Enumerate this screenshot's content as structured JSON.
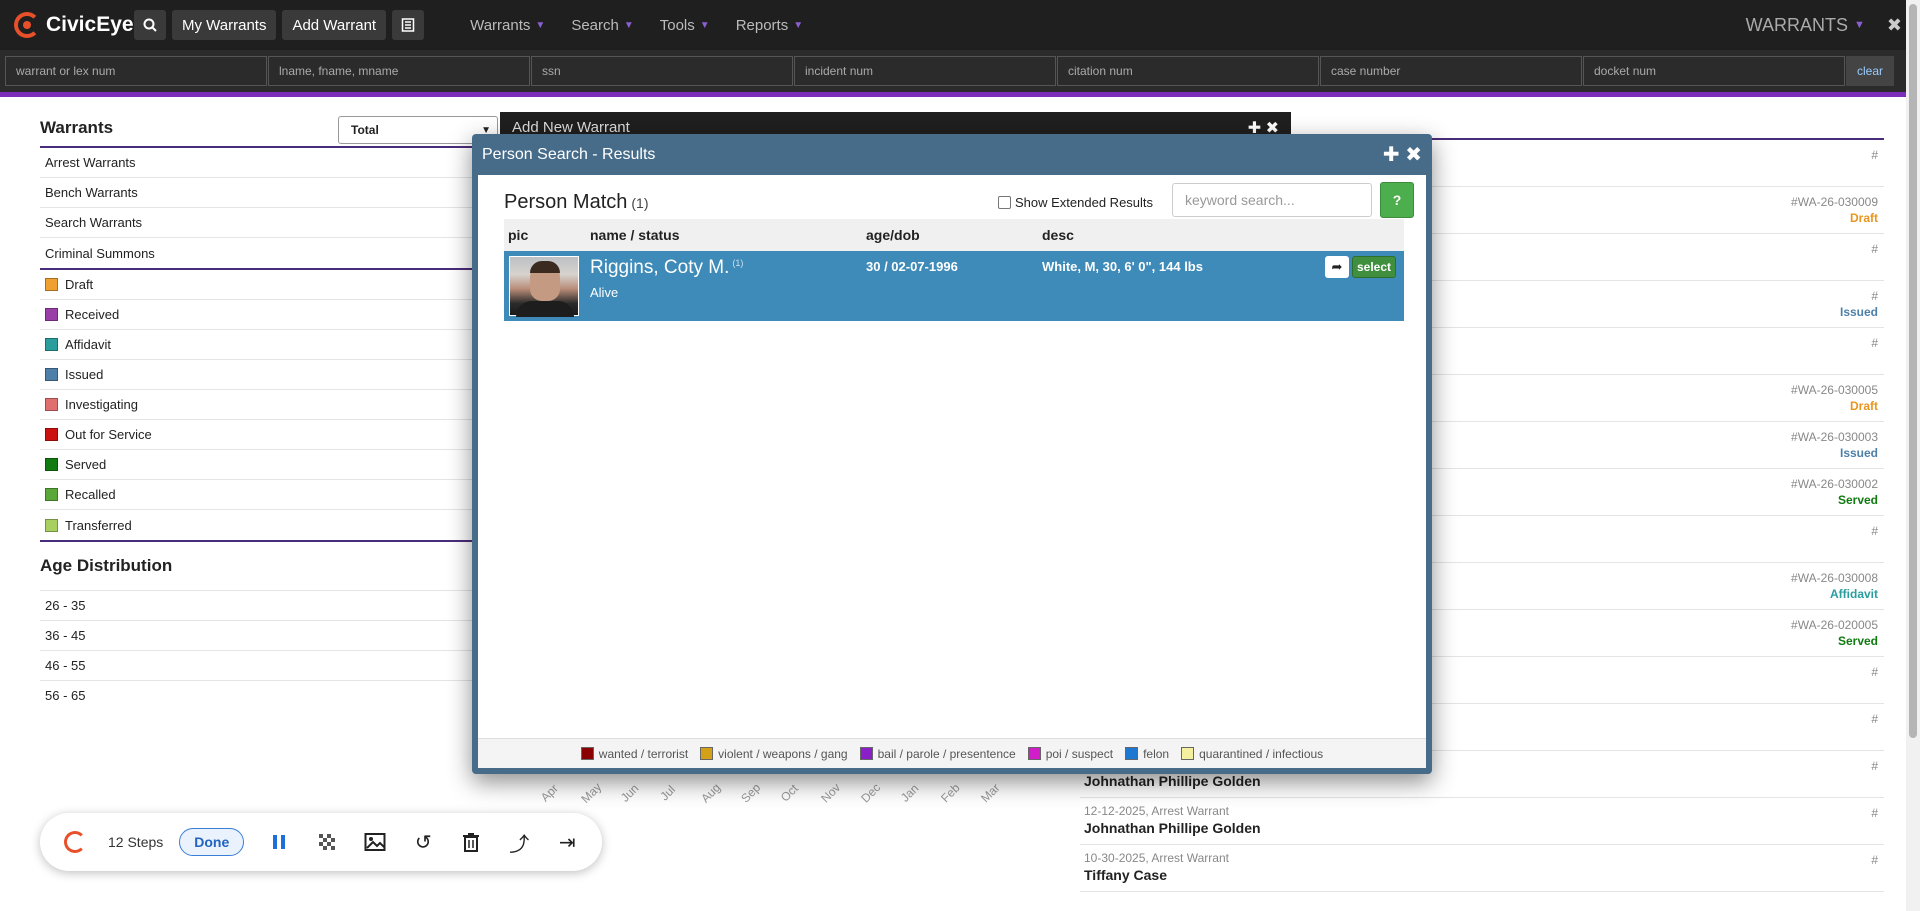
{
  "app": {
    "name": "CivicEye"
  },
  "topnav": {
    "my_warrants": "My Warrants",
    "add_warrant": "Add Warrant",
    "menus": [
      "Warrants",
      "Search",
      "Tools",
      "Reports"
    ],
    "module": "WARRANTS"
  },
  "search": {
    "placeholders": [
      "warrant or lex num",
      "lname, fname, mname",
      "ssn",
      "incident num",
      "citation num",
      "case number",
      "docket num"
    ],
    "clear": "clear"
  },
  "left": {
    "title": "Warrants",
    "select_value": "Total",
    "types": [
      "Arrest Warrants",
      "Bench Warrants",
      "Search Warrants",
      "Criminal Summons"
    ],
    "statuses": [
      {
        "label": "Draft",
        "color": "#f0a030"
      },
      {
        "label": "Received",
        "color": "#9b3fa8"
      },
      {
        "label": "Affidavit",
        "color": "#2a9d9d"
      },
      {
        "label": "Issued",
        "color": "#4e7fa8"
      },
      {
        "label": "Investigating",
        "color": "#e07070"
      },
      {
        "label": "Out for Service",
        "color": "#cc1111"
      },
      {
        "label": "Served",
        "color": "#117a11"
      },
      {
        "label": "Recalled",
        "color": "#5aa83a"
      },
      {
        "label": "Transferred",
        "color": "#a8d060"
      }
    ],
    "age_title": "Age Distribution",
    "ages": [
      "26 - 35",
      "36 - 45",
      "46 - 55",
      "56 - 65"
    ]
  },
  "add_new_warrant": {
    "title": "Add New Warrant"
  },
  "months": [
    "Apr",
    "May",
    "Jun",
    "Jul",
    "Aug",
    "Sep",
    "Oct",
    "Nov",
    "Dec",
    "Jan",
    "Feb",
    "Mar"
  ],
  "right_list": [
    {
      "hash": "#",
      "status": "",
      "color": ""
    },
    {
      "hash": "#WA-26-030009",
      "status": "Draft",
      "color": "#e8961e"
    },
    {
      "hash": "#",
      "status": "",
      "color": ""
    },
    {
      "hash": "#",
      "status": "Issued",
      "color": "#4e7fa8"
    },
    {
      "hash": "#",
      "status": "",
      "color": ""
    },
    {
      "hash": "#WA-26-030005",
      "status": "Draft",
      "color": "#e8961e"
    },
    {
      "hash": "#WA-26-030003",
      "status": "Issued",
      "color": "#4e7fa8"
    },
    {
      "hash": "#WA-26-030002",
      "status": "Served",
      "color": "#117a11"
    },
    {
      "hash": "#",
      "status": "",
      "color": ""
    },
    {
      "hash": "#WA-26-030008",
      "status": "Affidavit",
      "color": "#2a9d9d"
    },
    {
      "hash": "#WA-26-020005",
      "status": "Served",
      "color": "#117a11"
    },
    {
      "hash": "#",
      "status": "",
      "color": ""
    },
    {
      "hash": "#",
      "status": "",
      "color": ""
    },
    {
      "hash": "#",
      "name": "Johnathan Phillipe Golden",
      "meta": ""
    },
    {
      "hash": "#",
      "name": "Johnathan Phillipe Golden",
      "meta": "12-12-2025, Arrest Warrant"
    },
    {
      "hash": "#",
      "name": "Tiffany Case",
      "meta": "10-30-2025, Arrest Warrant"
    }
  ],
  "modal": {
    "title": "Person Search - Results",
    "match_title": "Person Match",
    "match_count": "(1)",
    "extended": "Show Extended Results",
    "keyword_placeholder": "keyword search...",
    "help": "?",
    "columns": [
      "pic",
      "name / status",
      "age/dob",
      "desc"
    ],
    "result": {
      "name": "Riggins, Coty M.",
      "name_sup": "(1)",
      "status": "Alive",
      "age_dob": "30 / 02-07-1996",
      "desc": "White, M, 30, 6' 0\", 144 lbs",
      "select": "select"
    },
    "legend": [
      {
        "label": "wanted / terrorist",
        "color": "#8b0000"
      },
      {
        "label": "violent / weapons / gang",
        "color": "#d4a017"
      },
      {
        "label": "bail / parole / presentence",
        "color": "#8a1ec8"
      },
      {
        "label": "poi / suspect",
        "color": "#d21ec8"
      },
      {
        "label": "felon",
        "color": "#1e78d2"
      },
      {
        "label": "quarantined / infectious",
        "color": "#f5f0a0"
      }
    ]
  },
  "bottombar": {
    "steps": "12 Steps",
    "done": "Done"
  }
}
